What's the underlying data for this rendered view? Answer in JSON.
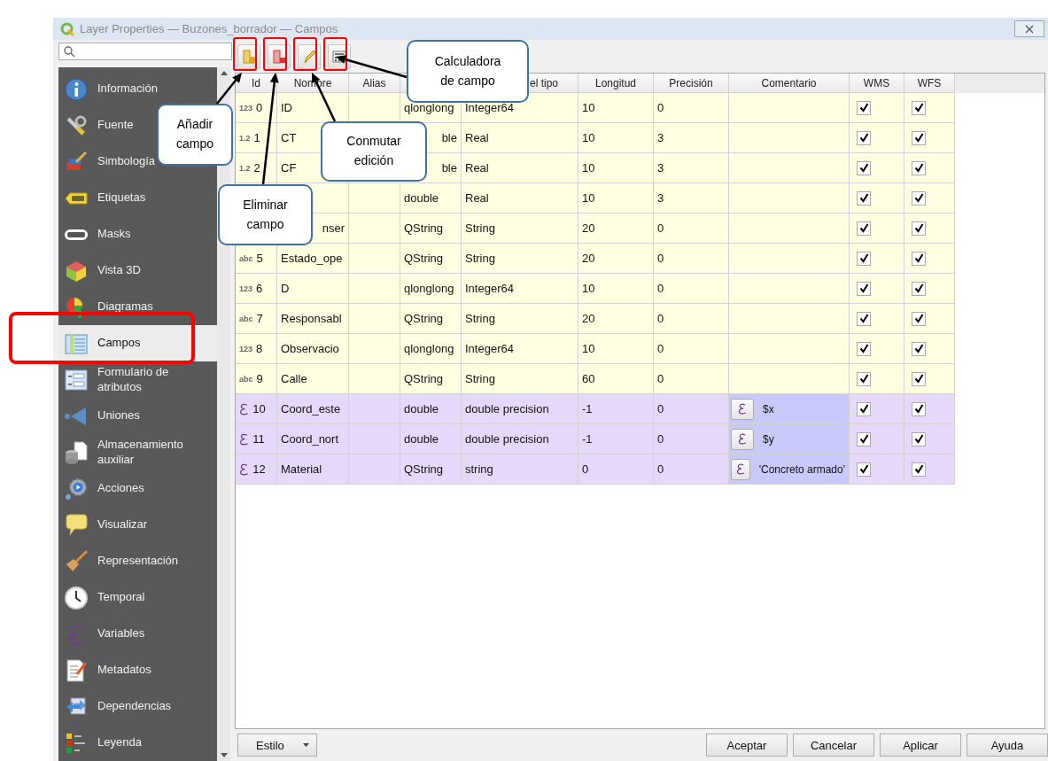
{
  "window": {
    "title": "Layer Properties — Buzones_borrador — Campos"
  },
  "sidebar": {
    "items": [
      {
        "label": "Información",
        "selected": false
      },
      {
        "label": "Fuente",
        "selected": false
      },
      {
        "label": "Simbología",
        "selected": false
      },
      {
        "label": "Etiquetas",
        "selected": false
      },
      {
        "label": "Masks",
        "selected": false
      },
      {
        "label": "Vista 3D",
        "selected": false
      },
      {
        "label": "Diagramas",
        "selected": false
      },
      {
        "label": "Campos",
        "selected": true
      },
      {
        "label": "Formulario de atributos",
        "selected": false
      },
      {
        "label": "Uniones",
        "selected": false
      },
      {
        "label": "Almacenamiento auxiliar",
        "selected": false
      },
      {
        "label": "Acciones",
        "selected": false
      },
      {
        "label": "Visualizar",
        "selected": false
      },
      {
        "label": "Representación",
        "selected": false
      },
      {
        "label": "Temporal",
        "selected": false
      },
      {
        "label": "Variables",
        "selected": false
      },
      {
        "label": "Metadatos",
        "selected": false
      },
      {
        "label": "Dependencias",
        "selected": false
      },
      {
        "label": "Leyenda",
        "selected": false
      }
    ]
  },
  "table": {
    "columns": [
      {
        "label": "Id"
      },
      {
        "label": "Nombre"
      },
      {
        "label": "Alias"
      },
      {},
      {
        "label": "el tipo",
        "cut": true
      },
      {
        "label": "Longitud"
      },
      {
        "label": "Precisión"
      },
      {
        "label": "Comentario"
      },
      {
        "label": "WMS"
      },
      {
        "label": "WFS"
      }
    ],
    "rows": [
      {
        "kind": "field",
        "type_icon": "123",
        "id": "0",
        "name": "ID",
        "type": "qlonglong",
        "type_name": "Integer64",
        "length": "10",
        "precision": "0",
        "wms": true,
        "wfs": true
      },
      {
        "kind": "field",
        "type_icon": "1.2",
        "id": "1",
        "name": "CT",
        "type": "ble",
        "type_cut": true,
        "type_name": "Real",
        "length": "10",
        "precision": "3",
        "wms": true,
        "wfs": true
      },
      {
        "kind": "field",
        "type_icon": "1.2",
        "id": "2",
        "name": "CF",
        "type": "ble",
        "type_cut": true,
        "type_name": "Real",
        "length": "10",
        "precision": "3",
        "wms": true,
        "wfs": true
      },
      {
        "kind": "field",
        "type": "double",
        "type_name": "Real",
        "length": "10",
        "precision": "3",
        "wms": true,
        "wfs": true
      },
      {
        "kind": "field",
        "name": "nser",
        "name_cut": true,
        "type": "QString",
        "type_name": "String",
        "length": "20",
        "precision": "0",
        "wms": true,
        "wfs": true
      },
      {
        "kind": "field",
        "type_icon": "abc",
        "id": "5",
        "name": "Estado_ope",
        "type": "QString",
        "type_name": "String",
        "length": "20",
        "precision": "0",
        "wms": true,
        "wfs": true
      },
      {
        "kind": "field",
        "type_icon": "123",
        "id": "6",
        "name": "D",
        "type": "qlonglong",
        "type_name": "Integer64",
        "length": "10",
        "precision": "0",
        "wms": true,
        "wfs": true
      },
      {
        "kind": "field",
        "type_icon": "abc",
        "id": "7",
        "name": "Responsabl",
        "type": "QString",
        "type_name": "String",
        "length": "20",
        "precision": "0",
        "wms": true,
        "wfs": true
      },
      {
        "kind": "field",
        "type_icon": "123",
        "id": "8",
        "name": "Observacio",
        "type": "qlonglong",
        "type_name": "Integer64",
        "length": "10",
        "precision": "0",
        "wms": true,
        "wfs": true
      },
      {
        "kind": "field",
        "type_icon": "abc",
        "id": "9",
        "name": "Calle",
        "type": "QString",
        "type_name": "String",
        "length": "60",
        "precision": "0",
        "wms": true,
        "wfs": true
      },
      {
        "kind": "virtual",
        "id": "10",
        "name": "Coord_este",
        "type": "double",
        "type_name": "double precision",
        "length": "-1",
        "precision": "0",
        "comment": "$x",
        "wms": true,
        "wfs": true
      },
      {
        "kind": "virtual",
        "id": "11",
        "name": "Coord_nort",
        "type": "double",
        "type_name": "double precision",
        "length": "-1",
        "precision": "0",
        "comment": "$y",
        "wms": true,
        "wfs": true
      },
      {
        "kind": "virtual",
        "id": "12",
        "name": "Material",
        "type": "QString",
        "type_name": "string",
        "length": "0",
        "precision": "0",
        "comment": "'Concreto armado'",
        "wms": true,
        "wfs": true
      }
    ]
  },
  "style_button": {
    "label": "Estilo"
  },
  "buttons": [
    {
      "label": "Aceptar"
    },
    {
      "label": "Cancelar"
    },
    {
      "label": "Aplicar"
    },
    {
      "label": "Ayuda"
    }
  ],
  "callouts": [
    {
      "text": "Añadir\ncampo"
    },
    {
      "text": "Eliminar\ncampo"
    },
    {
      "text": "Conmutar\nedición"
    },
    {
      "text": "Calculadora\nde campo"
    }
  ]
}
